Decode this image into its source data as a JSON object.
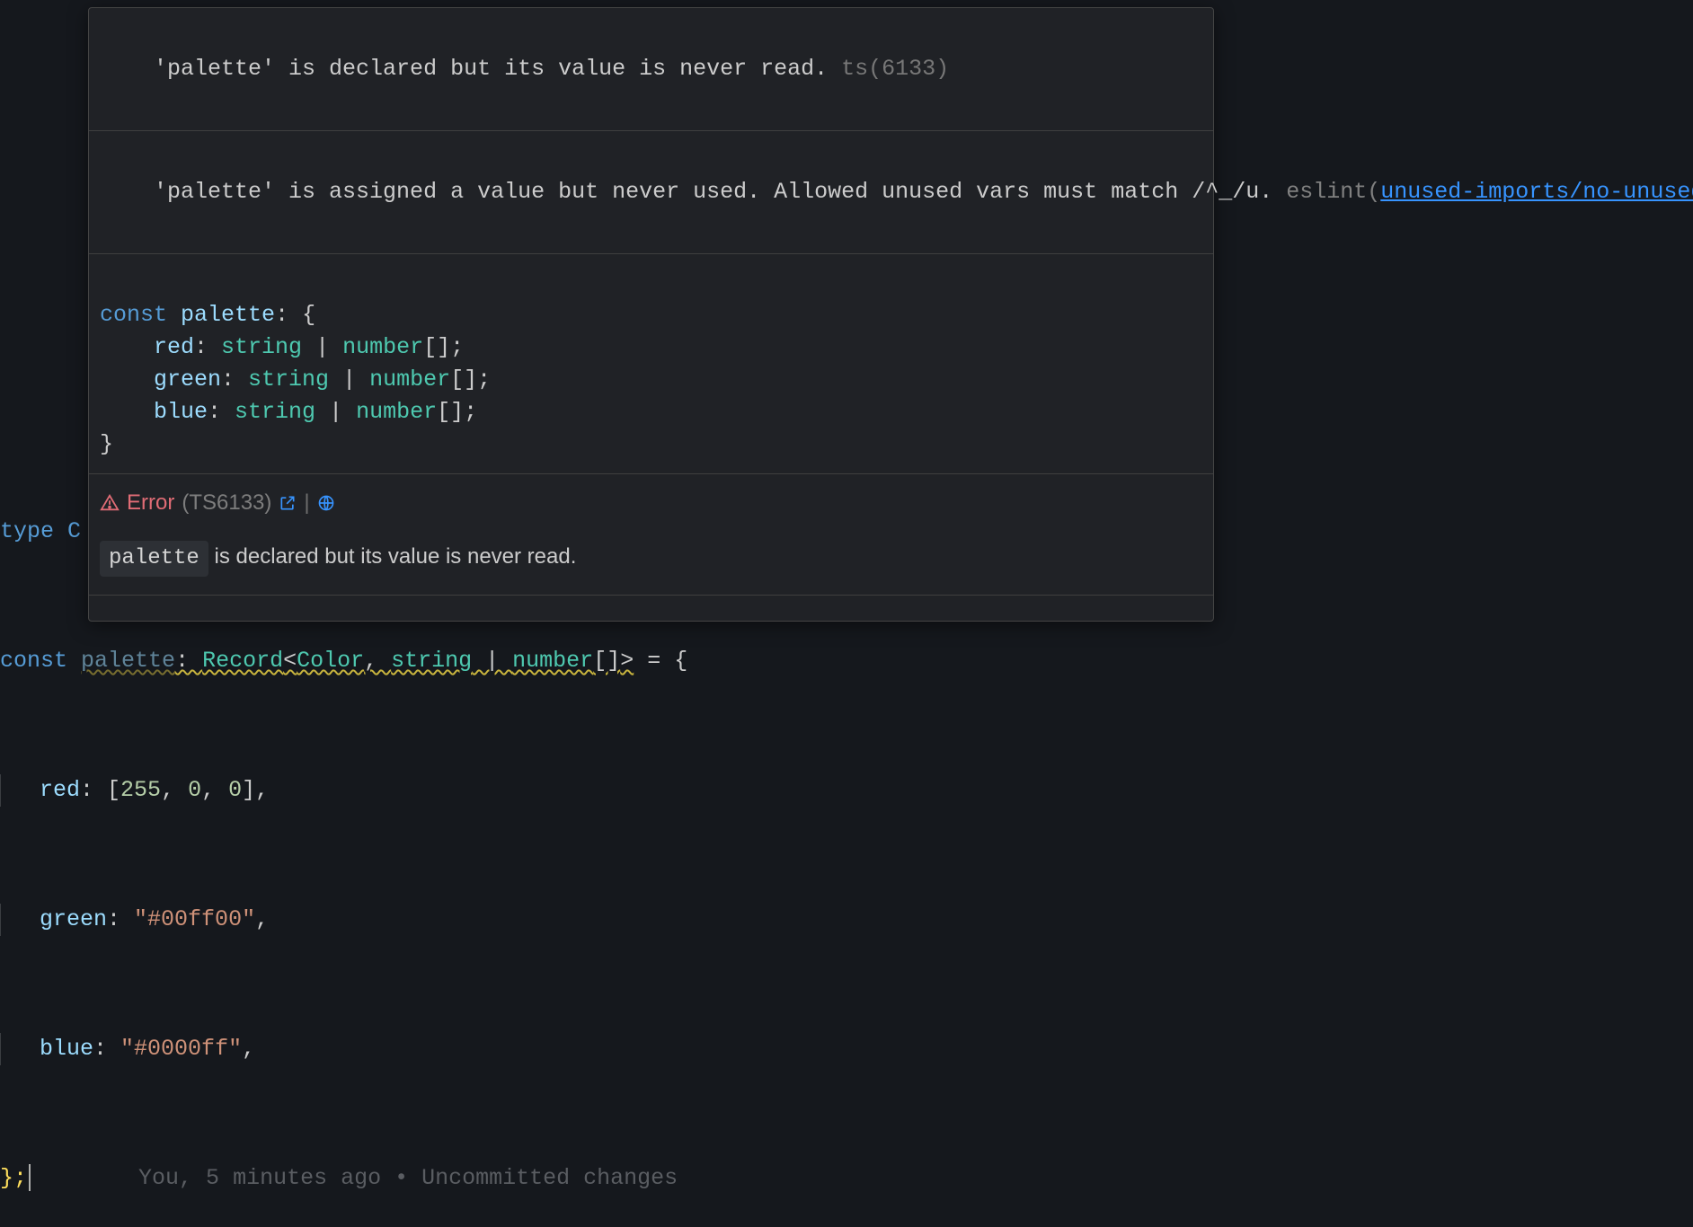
{
  "hover": {
    "ts_msg": "'palette' is declared but its value is never read.",
    "ts_code_suffix": " ts(6133)",
    "eslint_msg": "'palette' is assigned a value but never used. Allowed unused vars must match /^_/u.",
    "eslint_source": "eslint",
    "eslint_rule": "unused-imports/no-unused-vars",
    "type_decl": {
      "line1": "const palette: {",
      "line2": "    red: string | number[];",
      "line3": "    green: string | number[];",
      "line4": "    blue: string | number[];",
      "line5": "}",
      "tokens": {
        "kw_const": "const",
        "ident": "palette",
        "prop_red": "red",
        "prop_green": "green",
        "prop_blue": "blue",
        "ty_string": "string",
        "ty_number": "number"
      }
    },
    "error_row": {
      "label": "Error",
      "code": "(TS6133)"
    },
    "human": {
      "pill": "palette",
      "rest": " is declared but its value is never read."
    },
    "truncated_preview": "const palette: Record<Color, string | number[]>"
  },
  "editor": {
    "partial_type_line": "type C",
    "sig": {
      "kw_const": "const",
      "ident": "palette",
      "generic": "Record",
      "color_ty": "Color",
      "string_ty": "string",
      "number_ty": "number"
    },
    "red_key": "red",
    "red_vals": [
      "255",
      "0",
      "0"
    ],
    "green_key": "green",
    "green_val": "\"#00ff00\"",
    "blue_key": "blue",
    "blue_val": "\"#0000ff\"",
    "closing": "};",
    "gitlens": "You, 5 minutes ago • Uncommitted changes"
  }
}
